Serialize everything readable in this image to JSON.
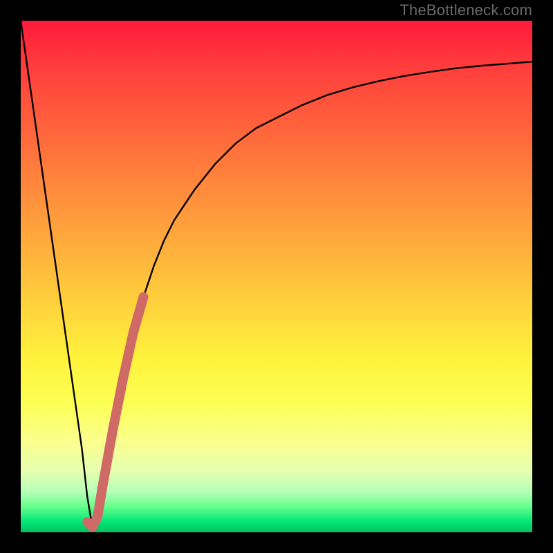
{
  "watermark": "TheBottleneck.com",
  "colors": {
    "curve": "#000000",
    "highlight": "#cf6a67",
    "background_frame": "#000000"
  },
  "chart_data": {
    "type": "line",
    "title": "",
    "xlabel": "",
    "ylabel": "",
    "xlim": [
      0,
      100
    ],
    "ylim": [
      0,
      100
    ],
    "grid": false,
    "description": "Bottleneck percentage curve: value drops steeply from ~100 at x=0 to ~0 near x≈14 (optimal point), then rises sharply and asymptotically approaches ~92 as x→100. A salmon-colored overlay marks the segment from the minimum up the rising branch (roughly x=13 to x=24).",
    "series": [
      {
        "name": "bottleneck-curve",
        "x": [
          0,
          2,
          4,
          6,
          8,
          10,
          12,
          13,
          14,
          15,
          16,
          18,
          20,
          22,
          24,
          26,
          28,
          30,
          34,
          38,
          42,
          46,
          50,
          55,
          60,
          65,
          70,
          75,
          80,
          85,
          90,
          95,
          100
        ],
        "y": [
          100,
          86,
          72,
          58,
          44,
          30,
          16,
          7,
          1,
          3,
          9,
          20,
          30,
          39,
          46,
          52,
          57,
          61,
          67,
          72,
          76,
          79,
          81,
          83.5,
          85.5,
          87,
          88.2,
          89.2,
          90,
          90.7,
          91.2,
          91.6,
          92
        ]
      },
      {
        "name": "highlight-segment",
        "x": [
          13,
          14,
          15,
          16,
          18,
          20,
          22,
          24
        ],
        "y": [
          2,
          1,
          3,
          9,
          20,
          30,
          39,
          46
        ]
      }
    ],
    "minimum_point": {
      "x": 14,
      "y": 1
    }
  }
}
